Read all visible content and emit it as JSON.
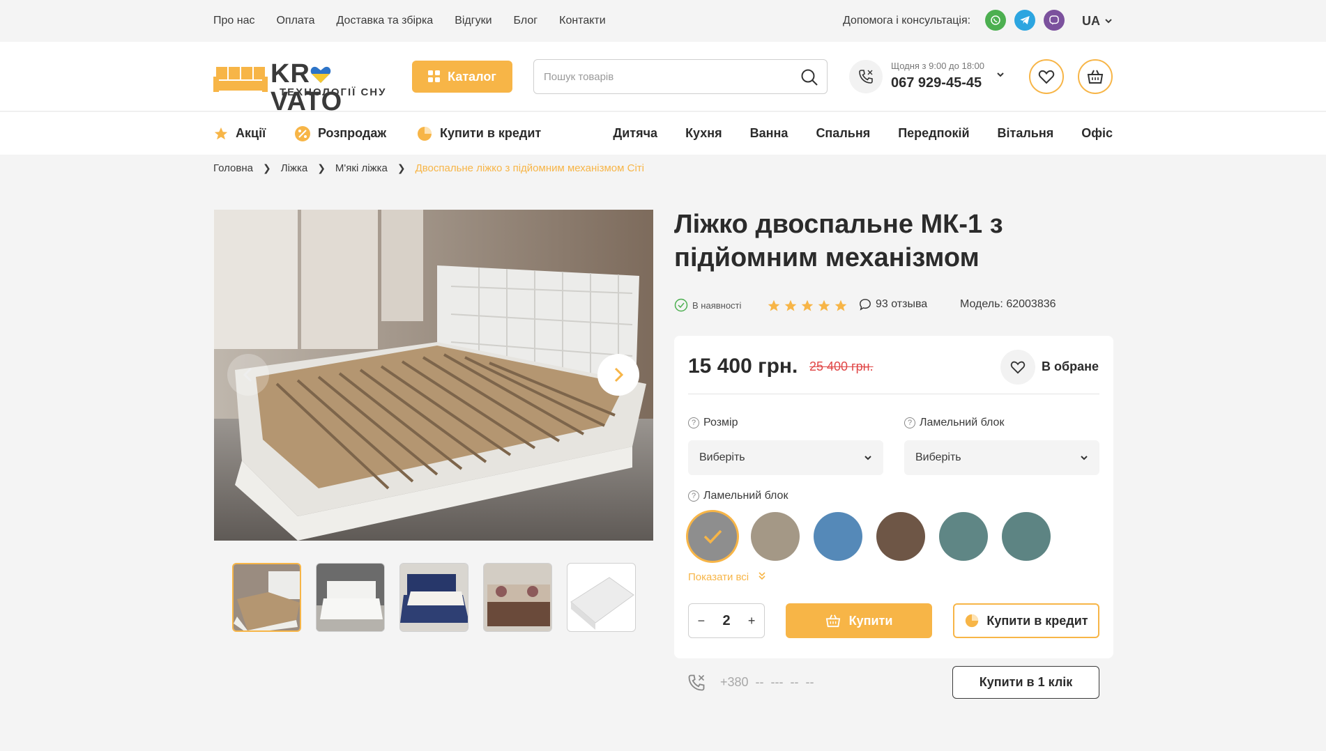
{
  "topnav": {
    "links": [
      "Про нас",
      "Оплата",
      "Доставка та збірка",
      "Відгуки",
      "Блог",
      "Контакти"
    ],
    "help_label": "Допомога і консультація:",
    "messengers": [
      {
        "icon": "whatsapp-icon",
        "color": "#4caf50"
      },
      {
        "icon": "telegram-icon",
        "color": "#2ca5e0"
      },
      {
        "icon": "viber-icon",
        "color": "#7b519d"
      }
    ],
    "language": "UA"
  },
  "header": {
    "logo_word_prefix": "KR",
    "logo_word_suffix": "VATO",
    "logo_subtitle": "ТЕХНОЛОГІЇ СНУ",
    "catalog_label": "Каталог",
    "search_placeholder": "Пошук товарів",
    "hours": "Щодня з 9:00 до 18:00",
    "phone": "067 929-45-45",
    "accent_color": "#f7b547"
  },
  "catnav": {
    "promos": [
      "Акції",
      "Розпродаж",
      "Купити в кредит"
    ],
    "rooms": [
      "Дитяча",
      "Кухня",
      "Ванна",
      "Спальня",
      "Передпокій",
      "Вітальня",
      "Офіс"
    ]
  },
  "breadcrumb": {
    "items": [
      "Головна",
      "Ліжка",
      "М'які ліжка"
    ],
    "current": "Двоспальне ліжко з підйомним механізмом Сіті"
  },
  "product": {
    "title": "Ліжко двоспальне МК-1 з підйомним механізмом",
    "stock": "В наявності",
    "rating": 5,
    "reviews": "93 отзыва",
    "model": "Модель: 62003836",
    "price": "15 400 грн.",
    "old_price": "25 400 грн.",
    "favorite_label": "В обране",
    "options": {
      "size_label": "Розмір",
      "size_value": "Виберіть",
      "lamel_label": "Ламельний блок",
      "lamel_value": "Виберіть",
      "color_label": "Ламельний блок"
    },
    "swatches": [
      "#8e8e8e",
      "#a49886",
      "#5589b8",
      "#6e5646",
      "#5f8685",
      "#5d8483"
    ],
    "show_all": "Показати всі",
    "quantity": "2",
    "buy_label": "Купити",
    "credit_label": "Купити в кредит",
    "oneclick_placeholder": "+380  --  ---  --  --",
    "oneclick_label": "Купити в 1 клік"
  }
}
